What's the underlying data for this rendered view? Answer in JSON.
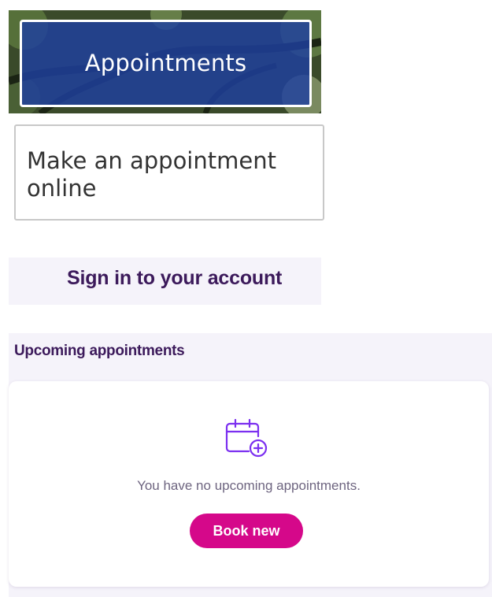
{
  "hero": {
    "title": "Appointments"
  },
  "make_appointment": {
    "title": "Make an appointment online"
  },
  "sign_in": {
    "label": "Sign in to your account"
  },
  "upcoming": {
    "heading": "Upcoming appointments",
    "icon": "calendar-add-icon",
    "empty_message": "You have no upcoming appointments.",
    "book_button_label": "Book new"
  },
  "colors": {
    "hero_overlay": "#1e40a0",
    "heading_purple": "#3c1a5b",
    "icon_purple": "#7b2ff0",
    "button_pink": "#d5088a",
    "panel_background": "#f5f3fa"
  }
}
